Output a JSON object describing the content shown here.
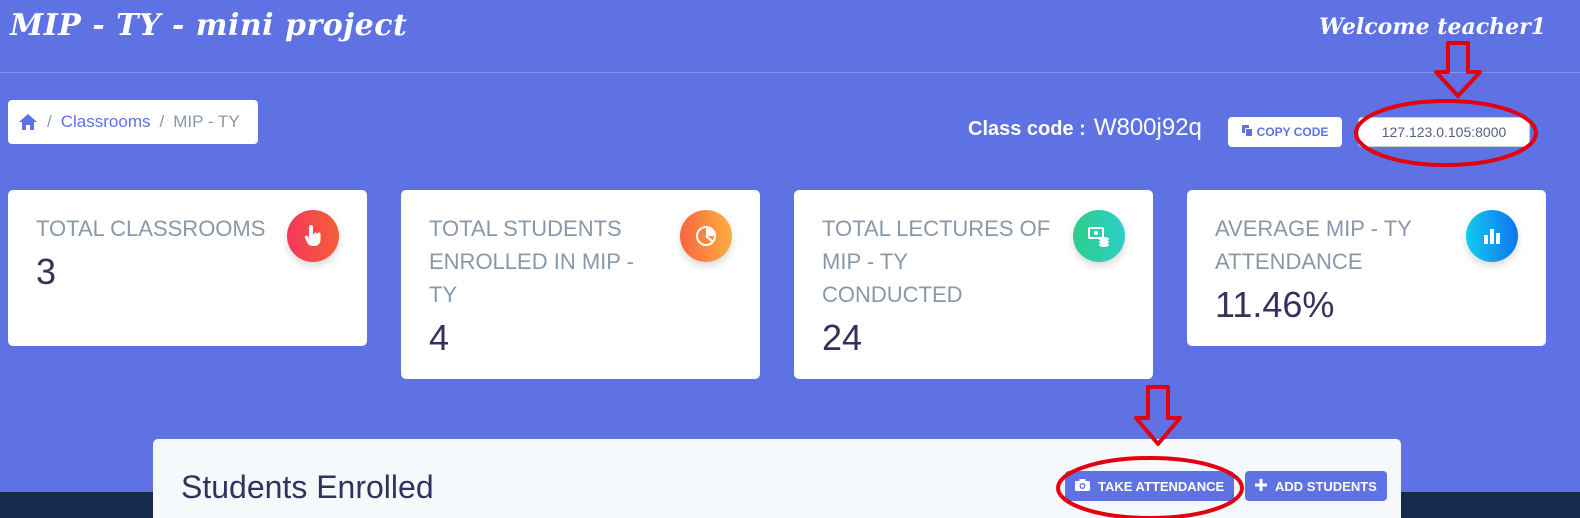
{
  "header": {
    "brand": "MIP - TY - mini project",
    "welcome": "Welcome teacher1"
  },
  "breadcrumb": {
    "home_icon": "home-icon",
    "items": [
      "Classrooms",
      "MIP - TY"
    ]
  },
  "class_code": {
    "label": "Class code :",
    "value": "W800j92q",
    "copy_label": "COPY CODE",
    "copy_icon": "copy-icon"
  },
  "url_field": {
    "value": "127.123.0.105:8000"
  },
  "stats": [
    {
      "title": "TOTAL CLASSROOMS",
      "value": "3",
      "icon": "hand-pointer-icon",
      "color": "#f5365c"
    },
    {
      "title": "TOTAL STUDENTS ENROLLED IN MIP - TY",
      "value": "4",
      "icon": "pie-chart-icon",
      "color": "#fb6340"
    },
    {
      "title": "TOTAL LECTURES OF MIP - TY CONDUCTED",
      "value": "24",
      "icon": "money-coins-icon",
      "color": "#2dce89"
    },
    {
      "title": "AVERAGE MIP - TY ATTENDANCE",
      "value": "11.46%",
      "icon": "bar-chart-icon",
      "color": "#11cdef"
    }
  ],
  "panel": {
    "title": "Students Enrolled",
    "take_attendance_label": "TAKE ATTENDANCE",
    "add_students_label": "ADD STUDENTS"
  },
  "colors": {
    "background": "#5e72e4",
    "annotation": "#e3000f"
  }
}
